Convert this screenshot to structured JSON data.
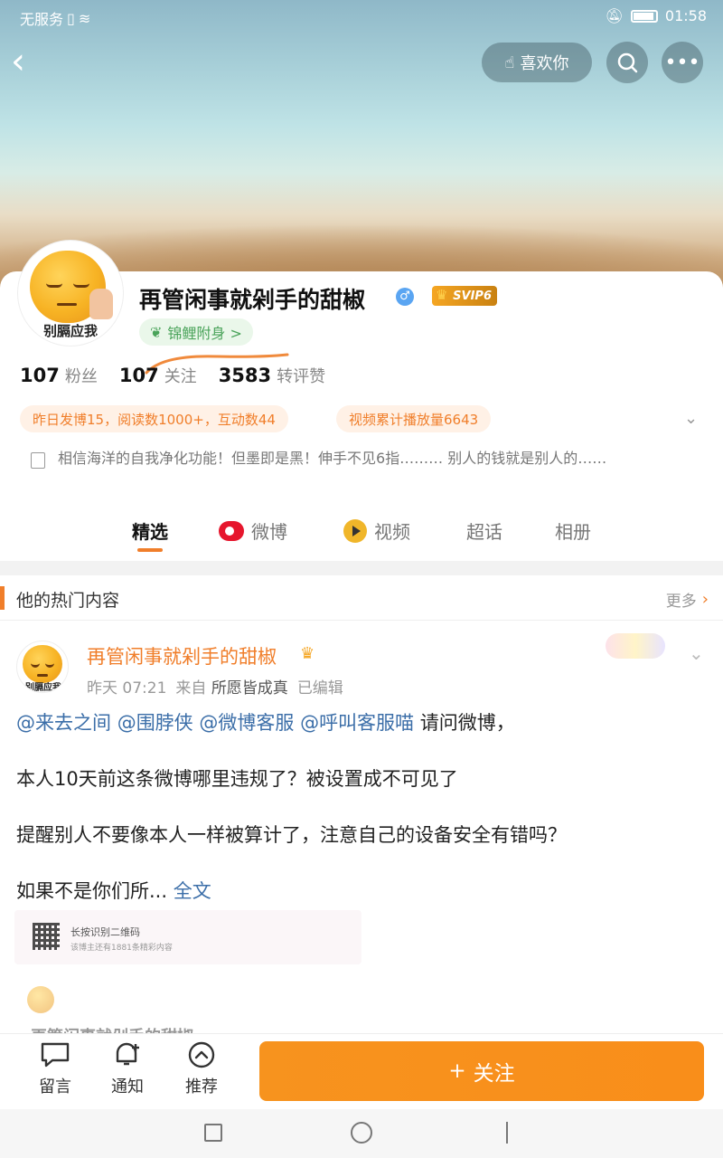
{
  "status_bar": {
    "carrier": "无服务",
    "time": "01:58"
  },
  "header": {
    "like_label": "喜欢你"
  },
  "profile": {
    "name": "再管闲事就剁手的甜椒",
    "gender_symbol": "♂",
    "vip_label": "SVIP6",
    "avatar_text": "别膈应我",
    "koi_label": "锦鲤附身 >",
    "stats": [
      {
        "value": "107",
        "label": "粉丝"
      },
      {
        "value": "107",
        "label": "关注"
      },
      {
        "value": "3583",
        "label": "转评赞"
      }
    ],
    "pills": [
      "昨日发博15，阅读数1000+，互动数44",
      "视频累计播放量6643"
    ],
    "bio": "相信海洋的自我净化功能！但墨即是黑！伸手不见6指……… 别人的钱就是别人的……"
  },
  "tabs": [
    "精选",
    "微博",
    "视频",
    "超话",
    "相册"
  ],
  "hot": {
    "title": "他的热门内容",
    "more_label": "更多"
  },
  "post": {
    "author": "再管闲事就剁手的甜椒",
    "time": "昨天 07:21",
    "from_label": "来自",
    "source": "所愿皆成真",
    "edited": "已编辑",
    "mentions": [
      "@来去之间",
      "@围脖侠",
      "@微博客服",
      "@呼叫客服喵"
    ],
    "line1_tail": "请问微博，",
    "line2": "本人10天前这条微博哪里违规了？被设置成不可见了",
    "line3": "提醒别人不要像本人一样被算计了，注意自己的设备安全有错吗？",
    "line4": "如果不是你们所...",
    "full_text_link": "全文",
    "qr_title": "长按识别二维码",
    "qr_sub": "该博主还有1881条精彩内容",
    "faded_name": "再管闲事就剁手的甜椒"
  },
  "toolbar": {
    "comment": "留言",
    "notify": "通知",
    "recommend": "推荐",
    "follow": "关注",
    "follow_plus": "+"
  },
  "colors": {
    "accent": "#f07e2a",
    "link": "#3b6ea8",
    "follow_btn": "#f7931e"
  }
}
